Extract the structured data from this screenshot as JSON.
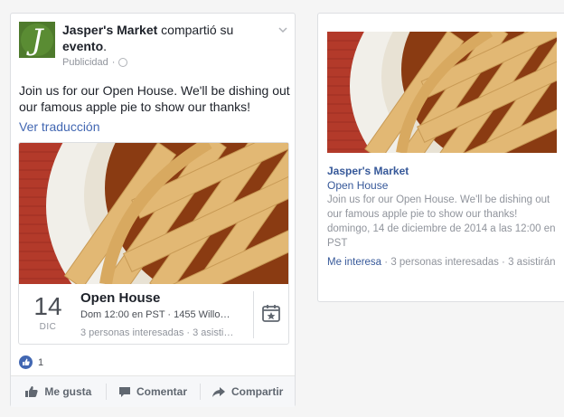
{
  "post": {
    "page_name": "Jasper's Market",
    "action_text": "compartió su",
    "object_text": "evento",
    "period": ".",
    "sponsored_label": "Publicidad",
    "sub_sep": "·",
    "logo_letter": "J",
    "body": "Join us for our Open House. We'll be dishing out our famous apple pie to show our thanks!",
    "translate_link": "Ver traducción",
    "event": {
      "day": "14",
      "month": "DIC",
      "title": "Open House",
      "details": "Dom 12:00 en PST · 1455 Willo…",
      "interest": "3 personas interesadas · 3 asisti…"
    },
    "like_count": "1",
    "actions": {
      "like": "Me gusta",
      "comment": "Comentar",
      "share": "Compartir"
    }
  },
  "ad": {
    "page_name": "Jasper's Market",
    "event_title": "Open House",
    "description": "Join us for our Open House. We'll be dishing out our famous apple pie to show our thanks!",
    "datetime": "domingo, 14 de diciembre de 2014 a las 12:00 en PST",
    "interest_link": "Me interesa",
    "interest_stats": " · 3 personas interesadas · 3 asistirán"
  },
  "colors": {
    "link": "#4267b2",
    "brand_green": "#4e7a2c",
    "table_red": "#b33a2a",
    "plate": "#f1efe9",
    "crust": "#e2b874",
    "filling": "#8a3b12"
  },
  "icons": [
    "chevron-down-icon",
    "globe-icon",
    "calendar-icon",
    "like-icon",
    "comment-icon",
    "share-icon"
  ]
}
